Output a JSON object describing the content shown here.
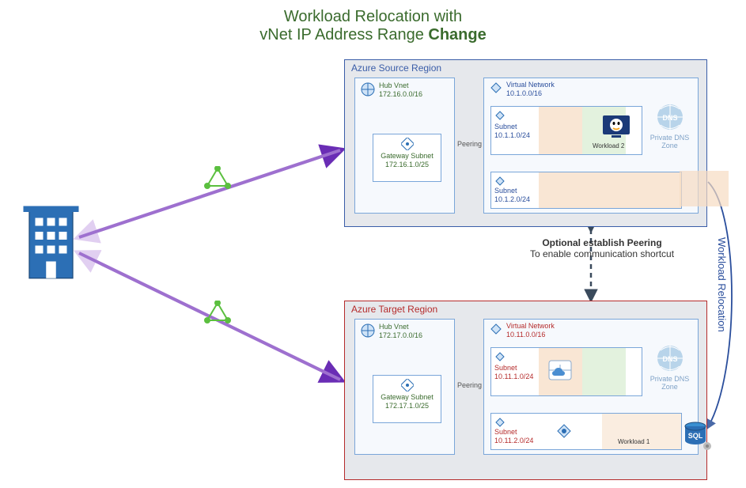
{
  "title": {
    "line1": "Workload Relocation with",
    "line2_prefix": "vNet IP Address Range ",
    "line2_bold": "Change"
  },
  "source": {
    "header": "Azure Source Region",
    "hub": {
      "label": "Hub Vnet",
      "cidr": "172.16.0.0/16",
      "gateway": {
        "label": "Gateway Subnet",
        "cidr": "172.16.1.0/25"
      }
    },
    "vnet": {
      "label": "Virtual Network",
      "cidr": "10.1.0.0/16",
      "subnets": [
        {
          "label": "Subnet",
          "cidr": "10.1.1.0/24",
          "workload": "Workload 2"
        },
        {
          "label": "Subnet",
          "cidr": "10.1.2.0/24"
        }
      ]
    },
    "dns": "Private DNS Zone",
    "peering": "Peering"
  },
  "target": {
    "header": "Azure Target Region",
    "hub": {
      "label": "Hub Vnet",
      "cidr": "172.17.0.0/16",
      "gateway": {
        "label": "Gateway Subnet",
        "cidr": "172.17.1.0/25"
      }
    },
    "vnet": {
      "label": "Virtual Network",
      "cidr": "10.11.0.0/16",
      "subnets": [
        {
          "label": "Subnet",
          "cidr": "10.11.1.0/24"
        },
        {
          "label": "Subnet",
          "cidr": "10.11.2.0/24",
          "workload": "Workload 1"
        }
      ]
    },
    "dns": "Private DNS Zone",
    "peering": "Peering"
  },
  "center": {
    "optHeader": "Optional establish Peering",
    "optBody": "To enable communication shortcut",
    "relocation": "Workload Relocation"
  },
  "icons": {
    "building": "building-icon",
    "mesh": "mesh-icon",
    "dns": "dns-icon",
    "vnet": "vnet-icon",
    "vm": "vm-linux-icon",
    "sql": "sql-icon",
    "cloud": "cloud-icon",
    "pe": "private-endpoint-icon"
  }
}
